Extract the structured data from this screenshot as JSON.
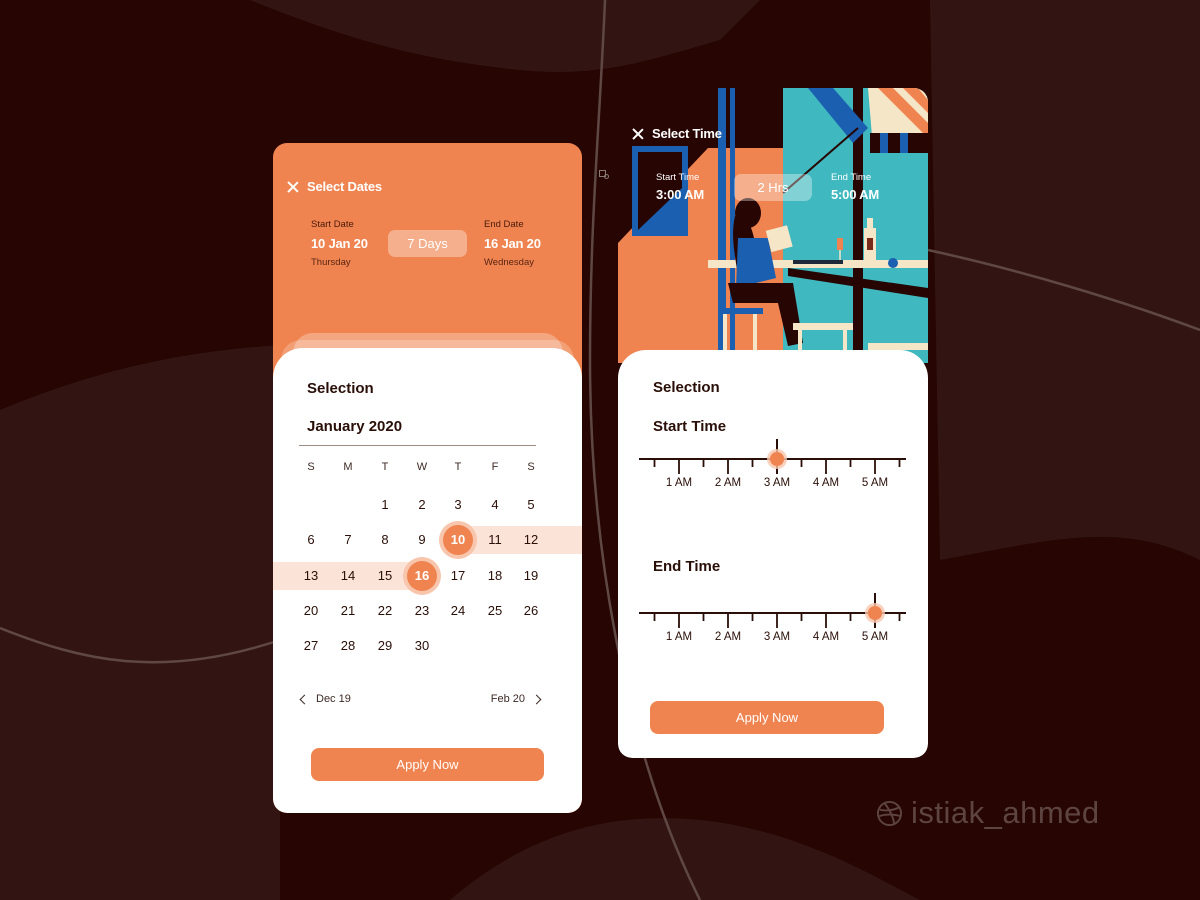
{
  "date_card": {
    "title": "Select Dates",
    "start_label": "Start Date",
    "start_value": "10 Jan 20",
    "start_day": "Thursday",
    "duration": "7 Days",
    "end_label": "End Date",
    "end_value": "16 Jan 20",
    "end_day": "Wednesday",
    "selection_title": "Selection",
    "month_label": "January 2020",
    "weekdays": [
      "S",
      "M",
      "T",
      "W",
      "T",
      "F",
      "S"
    ],
    "weeks": [
      [
        "",
        "",
        "1",
        "2",
        "3",
        "4",
        "5"
      ],
      [
        "6",
        "7",
        "8",
        "9",
        "10",
        "11",
        "12"
      ],
      [
        "13",
        "14",
        "15",
        "16",
        "17",
        "18",
        "19"
      ],
      [
        "20",
        "21",
        "22",
        "23",
        "24",
        "25",
        "26"
      ],
      [
        "27",
        "28",
        "29",
        "30",
        "",
        "",
        ""
      ]
    ],
    "range_start": "10",
    "range_end": "16",
    "prev_month": "Dec 19",
    "next_month": "Feb 20",
    "apply_label": "Apply Now"
  },
  "time_card": {
    "title": "Select Time",
    "start_label": "Start Time",
    "start_value": "3:00 AM",
    "duration": "2 Hrs",
    "end_label": "End Time",
    "end_value": "5:00 AM",
    "selection_title": "Selection",
    "start_slider": {
      "title": "Start Time",
      "tick_labels": [
        "1 AM",
        "2 AM",
        "3 AM",
        "4 AM",
        "5 AM"
      ],
      "value_hour": 3
    },
    "end_slider": {
      "title": "End Time",
      "tick_labels": [
        "1 AM",
        "2 AM",
        "3 AM",
        "4 AM",
        "5 AM"
      ],
      "value_hour": 5
    },
    "apply_label": "Apply Now"
  },
  "colors": {
    "accent": "#f08450",
    "accent_light": "#fbe3d8",
    "background": "#260503",
    "text_dark": "#2a0f08"
  },
  "watermark": {
    "icon": "dribbble-icon",
    "text": "istiak_ahmed"
  }
}
